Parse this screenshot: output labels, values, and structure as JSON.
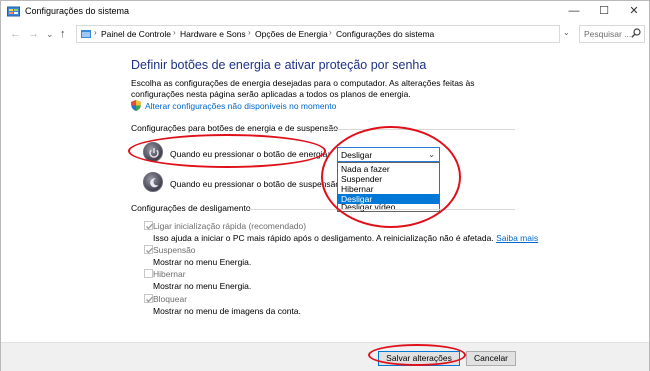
{
  "window": {
    "title": "Configurações do sistema",
    "minimize": "—",
    "maximize": "☐",
    "close": "✕"
  },
  "nav": {
    "back": "←",
    "forward": "→",
    "recent": "⌄",
    "up": "↑",
    "breadcrumbs": [
      "Painel de Controle",
      "Hardware e Sons",
      "Opções de Energia",
      "Configurações do sistema"
    ],
    "separator": "›",
    "search_placeholder": "Pesquisar ..."
  },
  "main": {
    "heading": "Definir botões de energia e ativar proteção por senha",
    "description": "Escolha as configurações de energia desejadas para o computador. As alterações feitas às configurações nesta página serão aplicadas a todos os planos de energia.",
    "change_unavailable_link": "Alterar configurações não disponíveis no momento",
    "power_section": {
      "title": "Configurações para botões de energia e de suspensão",
      "power_button_label": "Quando eu pressionar o botão de energia:",
      "sleep_button_label": "Quando eu pressionar o botão de suspensão:",
      "selected_value": "Desligar",
      "options": [
        "Nada a fazer",
        "Suspender",
        "Hibernar",
        "Desligar",
        "Desligar vídeo"
      ],
      "selected_index": 3
    },
    "shutdown_section": {
      "title": "Configurações de desligamento",
      "items": [
        {
          "label": "Ligar inicialização rápida (recomendado)",
          "checked": true,
          "desc": "Isso ajuda a iniciar o PC mais rápido após o desligamento. A reinicialização não é afetada.",
          "link": "Saiba mais"
        },
        {
          "label": "Suspensão",
          "checked": true,
          "desc": "Mostrar no menu Energia."
        },
        {
          "label": "Hibernar",
          "checked": false,
          "desc": "Mostrar no menu Energia."
        },
        {
          "label": "Bloquear",
          "checked": true,
          "desc": "Mostrar no menu de imagens da conta."
        }
      ]
    }
  },
  "footer": {
    "save": "Salvar alterações",
    "cancel": "Cancelar"
  },
  "colors": {
    "heading": "#1e3287",
    "link": "#0066cc",
    "selection": "#0078d7",
    "annotation": "#e0101a"
  }
}
